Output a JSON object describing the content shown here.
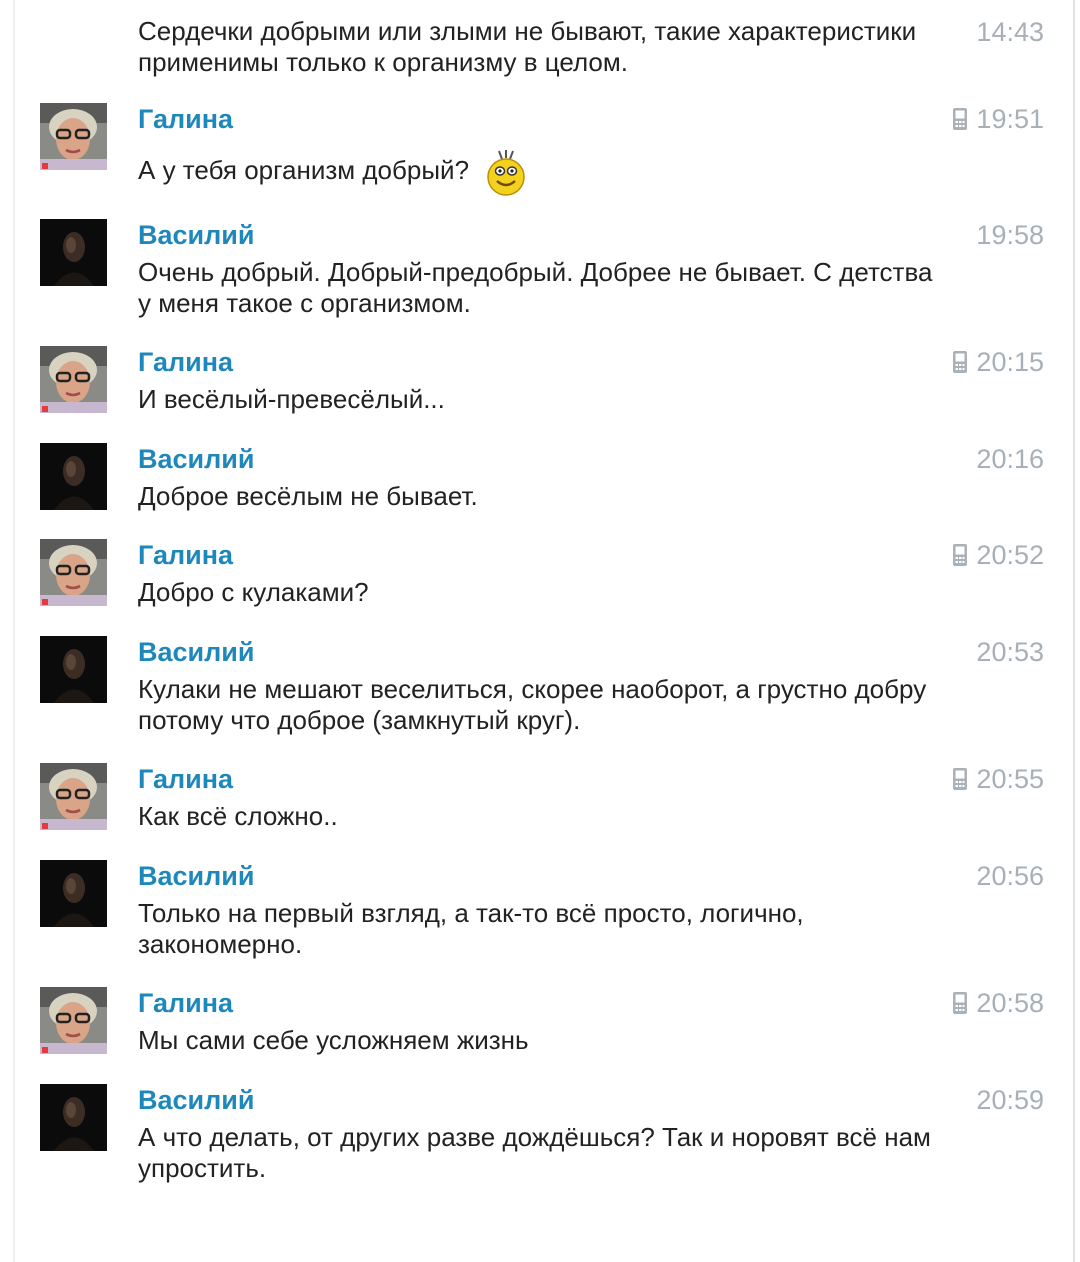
{
  "messages": [
    {
      "author": "",
      "time": "14:43",
      "mobile": false,
      "text": "Сердечки добрыми или злыми не бывают, такие характеристики применимы только к организму в целом."
    },
    {
      "author": "Галина",
      "time": "19:51",
      "mobile": true,
      "text": "А у тебя организм добрый?",
      "emoji": "smiley-emoji"
    },
    {
      "author": "Василий",
      "time": "19:58",
      "mobile": false,
      "text": "Очень добрый. Добрый-предобрый. Добрее не бывает. С детства у меня такое с организмом."
    },
    {
      "author": "Галина",
      "time": "20:15",
      "mobile": true,
      "text": "И весёлый-превесёлый..."
    },
    {
      "author": "Василий",
      "time": "20:16",
      "mobile": false,
      "text": "Доброе весёлым не бывает."
    },
    {
      "author": "Галина",
      "time": "20:52",
      "mobile": true,
      "text": "Добро с кулаками?"
    },
    {
      "author": "Василий",
      "time": "20:53",
      "mobile": false,
      "text": "Кулаки не мешают веселиться, скорее наоборот, а грустно добру потому что доброе (замкнутый круг)."
    },
    {
      "author": "Галина",
      "time": "20:55",
      "mobile": true,
      "text": "Как всё сложно.."
    },
    {
      "author": "Василий",
      "time": "20:56",
      "mobile": false,
      "text": "Только на первый взгляд, а так-то всё просто, логично, закономерно."
    },
    {
      "author": "Галина",
      "time": "20:58",
      "mobile": true,
      "text": "Мы сами себе усложняем жизнь"
    },
    {
      "author": "Василий",
      "time": "20:59",
      "mobile": false,
      "text": "А что делать, от других разве дождёшься? Так и норовят всё нам упростить."
    }
  ],
  "colors": {
    "author_name": "#1e88bd",
    "timestamp": "#a8b0b7",
    "message_text": "#222222"
  },
  "icons": {
    "mobile": "mobile-phone-icon",
    "emoji": "smiley-emoji"
  }
}
